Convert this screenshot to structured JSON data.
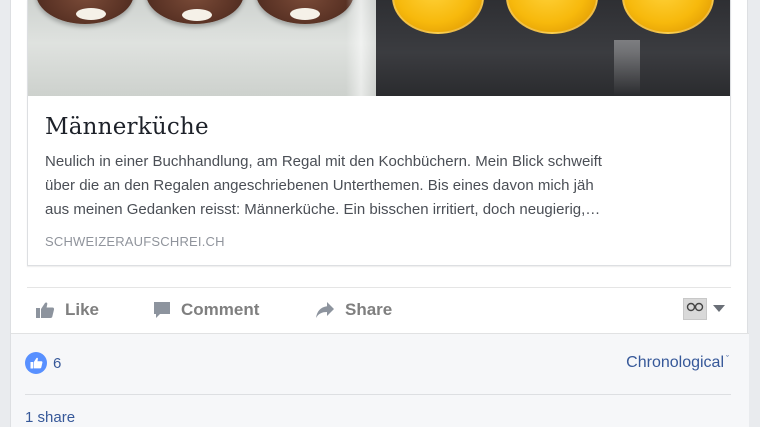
{
  "link_card": {
    "title": "Männerküche",
    "description": "Neulich in einer Buchhandlung, am Regal mit den Kochbüchern. Mein Blick schweift\nüber die an den Regalen angeschriebenen Unterthemen. Bis eines davon mich jäh\naus meinen Gedanken reisst: Männerküche. Ein bisschen irritiert, doch neugierig,…",
    "domain": "SCHWEIZERAUFSCHREI.CH"
  },
  "actions": {
    "like": "Like",
    "comment": "Comment",
    "share": "Share"
  },
  "icons": {
    "like": "thumbs-up-icon",
    "comment": "speech-bubble-icon",
    "share": "share-arrow-icon",
    "audience_caret": "caret-down-icon",
    "likes_badge": "like-badge-icon"
  },
  "reactions": {
    "count": "6"
  },
  "sort": {
    "label": "Chronological",
    "caret": "ˇ"
  },
  "shares": {
    "label": "1 share"
  },
  "colors": {
    "link_blue": "#365899",
    "like_badge": "#5890ff",
    "action_gray": "#7f7f7f",
    "footer_bg": "#f6f7f9"
  }
}
